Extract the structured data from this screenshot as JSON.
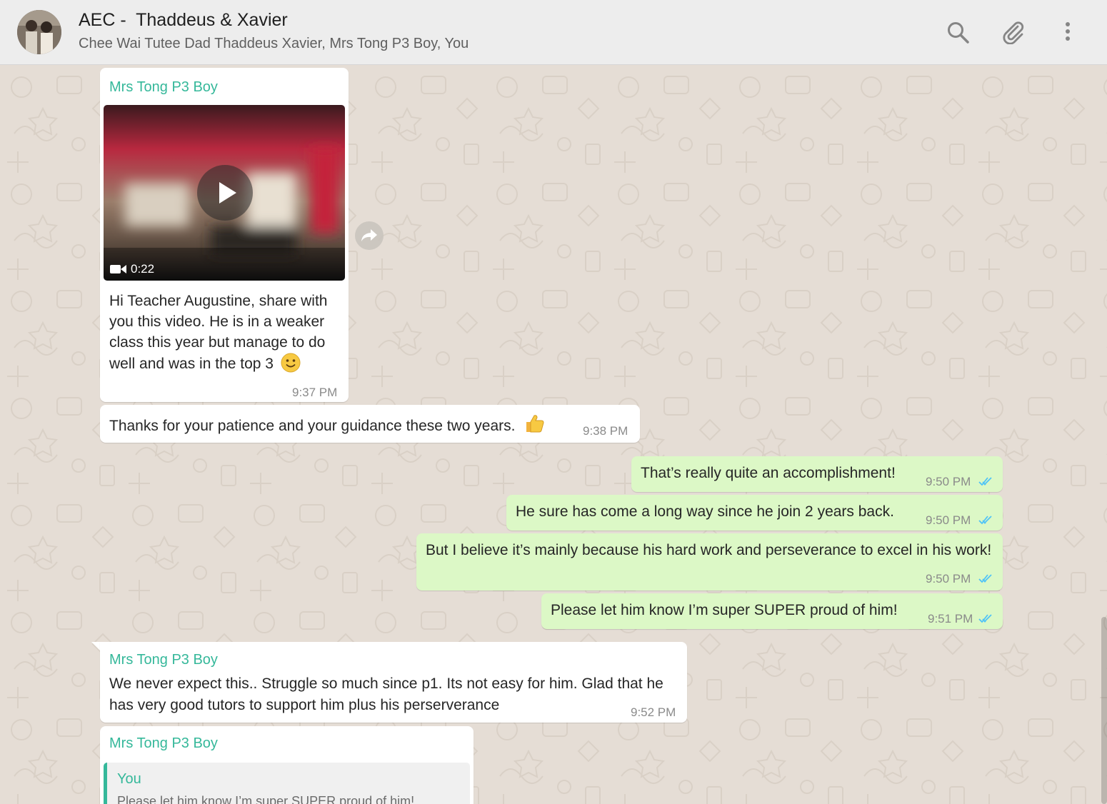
{
  "header": {
    "title": "AEC -  Thaddeus & Xavier",
    "subtitle": "Chee Wai Tutee Dad Thaddeus Xavier, Mrs Tong P3 Boy, You",
    "icons": [
      "search-icon",
      "paperclip-icon",
      "more-vertical-icon"
    ]
  },
  "messages": {
    "m1": {
      "sender": "Mrs Tong P3 Boy",
      "video_duration": "0:22",
      "text": "Hi Teacher Augustine, share with you this video.  He is in a weaker class this year but manage to do well and was in the top 3",
      "emoji": "slightly-smiling-face",
      "time": "9:37 PM"
    },
    "m2": {
      "text": "Thanks for your patience and your guidance these two years.",
      "emoji": "thumbs-up",
      "time": "9:38 PM"
    },
    "m3": {
      "text": "That’s really quite an accomplishment!",
      "time": "9:50 PM",
      "status": "read"
    },
    "m4": {
      "text": "He sure has come a long way since he join 2 years back.",
      "time": "9:50 PM",
      "status": "read"
    },
    "m5": {
      "text": "But I believe it’s mainly because his hard work and perseverance to excel in his work!",
      "time": "9:50 PM",
      "status": "read"
    },
    "m6": {
      "text": "Please let him know I’m super SUPER proud of him!",
      "time": "9:51 PM",
      "status": "read"
    },
    "m7": {
      "sender": "Mrs Tong P3 Boy",
      "text": "We never expect this.. Struggle so much since p1. Its not easy for him. Glad that he has very good tutors to support him plus his perserverance",
      "time": "9:52 PM"
    },
    "m8": {
      "sender": "Mrs Tong P3 Boy",
      "quote_name": "You",
      "quote_text": "Please let him know I’m super SUPER proud of him!"
    }
  },
  "colors": {
    "incoming_bubble": "#ffffff",
    "outgoing_bubble": "#dcf8c6",
    "sender_name": "#35b89a",
    "read_ticks": "#4fc3f7",
    "wallpaper": "#e5ddd5"
  }
}
